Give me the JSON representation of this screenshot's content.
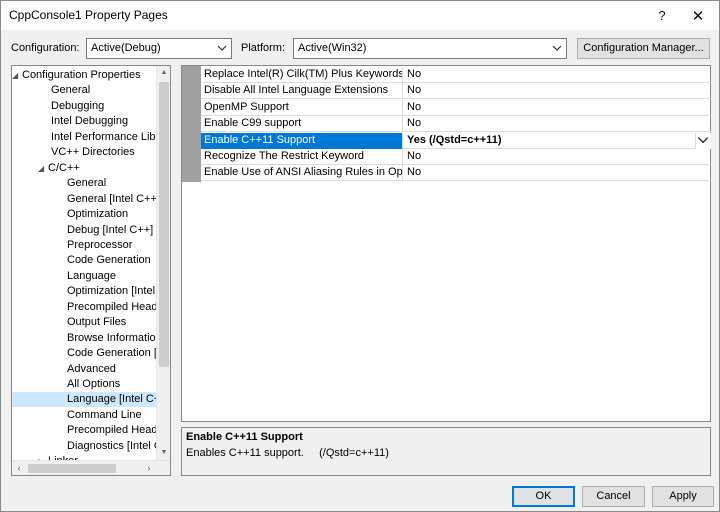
{
  "window": {
    "title": "CppConsole1 Property Pages",
    "help_label": "?",
    "close_label": "✕"
  },
  "config_bar": {
    "configuration_label": "Configuration:",
    "configuration_value": "Active(Debug)",
    "platform_label": "Platform:",
    "platform_value": "Active(Win32)",
    "config_manager_label": "Configuration Manager..."
  },
  "tree": {
    "items": [
      {
        "label": "Configuration Properties",
        "expander": "◢",
        "level": 0
      },
      {
        "label": "General",
        "expander": "",
        "level": 1
      },
      {
        "label": "Debugging",
        "expander": "",
        "level": 1
      },
      {
        "label": "Intel Debugging",
        "expander": "",
        "level": 1
      },
      {
        "label": "Intel Performance Libra",
        "expander": "",
        "level": 1
      },
      {
        "label": "VC++ Directories",
        "expander": "",
        "level": 1
      },
      {
        "label": "C/C++",
        "expander": "◢",
        "level": 1
      },
      {
        "label": "General",
        "expander": "",
        "level": 2
      },
      {
        "label": "General [Intel C++]",
        "expander": "",
        "level": 2
      },
      {
        "label": "Optimization",
        "expander": "",
        "level": 2
      },
      {
        "label": "Debug [Intel C++]",
        "expander": "",
        "level": 2
      },
      {
        "label": "Preprocessor",
        "expander": "",
        "level": 2
      },
      {
        "label": "Code Generation",
        "expander": "",
        "level": 2
      },
      {
        "label": "Language",
        "expander": "",
        "level": 2
      },
      {
        "label": "Optimization [Intel",
        "expander": "",
        "level": 2
      },
      {
        "label": "Precompiled Heade",
        "expander": "",
        "level": 2
      },
      {
        "label": "Output Files",
        "expander": "",
        "level": 2
      },
      {
        "label": "Browse Information",
        "expander": "",
        "level": 2
      },
      {
        "label": "Code Generation [Ir",
        "expander": "",
        "level": 2
      },
      {
        "label": "Advanced",
        "expander": "",
        "level": 2
      },
      {
        "label": "All Options",
        "expander": "",
        "level": 2
      },
      {
        "label": "Language [Intel C++",
        "expander": "",
        "level": 2,
        "selected": true
      },
      {
        "label": "Command Line",
        "expander": "",
        "level": 2
      },
      {
        "label": "Precompiled Heade",
        "expander": "",
        "level": 2
      },
      {
        "label": "Diagnostics [Intel C",
        "expander": "",
        "level": 2
      },
      {
        "label": "Linker",
        "expander": "▷",
        "level": 1
      }
    ]
  },
  "grid": {
    "rows": [
      {
        "name": "Replace Intel(R) Cilk(TM) Plus Keywords Wit",
        "value": "No"
      },
      {
        "name": "Disable All Intel Language Extensions",
        "value": "No"
      },
      {
        "name": "OpenMP Support",
        "value": "No"
      },
      {
        "name": "Enable C99 support",
        "value": "No"
      },
      {
        "name": "Enable C++11 Support",
        "value": "Yes (/Qstd=c++11)",
        "selected": true
      },
      {
        "name": "Recognize The Restrict Keyword",
        "value": "No"
      },
      {
        "name": "Enable Use of ANSI Aliasing Rules in Optimi:",
        "value": "No"
      }
    ]
  },
  "description": {
    "title": "Enable C++11 Support",
    "text": "Enables C++11 support.     (/Qstd=c++11)"
  },
  "buttons": {
    "ok_label": "OK",
    "cancel_label": "Cancel",
    "apply_label": "Apply"
  },
  "colors": {
    "selection_blue": "#0078d7",
    "tree_selection": "#cce8ff",
    "row_header_gray": "#a0a0a0"
  }
}
